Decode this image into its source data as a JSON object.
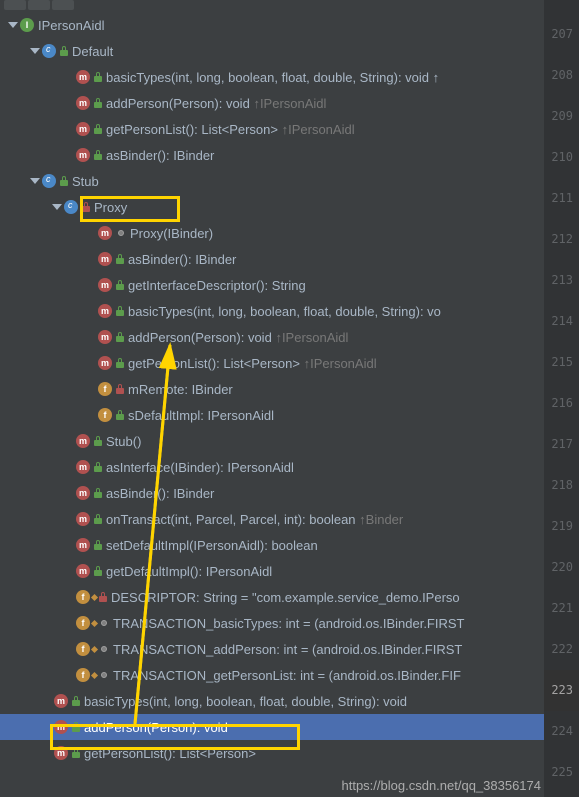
{
  "gutter": {
    "start": 207,
    "end": 225,
    "active": 223
  },
  "tree": {
    "root": {
      "label": "IPersonAidl",
      "children": [
        {
          "label": "Default",
          "methods": [
            {
              "sig": "basicTypes(int, long, boolean, float, double, String): void ↑"
            },
            {
              "sig": "addPerson(Person): void",
              "inherit": "↑IPersonAidl"
            },
            {
              "sig": "getPersonList(): List<Person>",
              "inherit": "↑IPersonAidl"
            },
            {
              "sig": "asBinder(): IBinder"
            }
          ]
        },
        {
          "label": "Stub",
          "proxy": {
            "label": "Proxy",
            "items": [
              {
                "type": "ctor",
                "sig": "Proxy(IBinder)"
              },
              {
                "type": "m",
                "sig": "asBinder(): IBinder"
              },
              {
                "type": "m",
                "sig": "getInterfaceDescriptor(): String"
              },
              {
                "type": "m",
                "sig": "basicTypes(int, long, boolean, float, double, String): vo"
              },
              {
                "type": "m",
                "sig": "addPerson(Person): void",
                "inherit": "↑IPersonAidl"
              },
              {
                "type": "m",
                "sig": "getPersonList(): List<Person>",
                "inherit": "↑IPersonAidl"
              },
              {
                "type": "f",
                "lock": "red",
                "sig": "mRemote: IBinder"
              },
              {
                "type": "f",
                "lock": "green",
                "sig": "sDefaultImpl: IPersonAidl"
              }
            ]
          },
          "stub_methods": [
            {
              "type": "m",
              "sig": "Stub()"
            },
            {
              "type": "m",
              "sig": "asInterface(IBinder): IPersonAidl"
            },
            {
              "type": "m",
              "sig": "asBinder(): IBinder"
            },
            {
              "type": "m",
              "sig": "onTransact(int, Parcel, Parcel, int): boolean",
              "inherit": "↑Binder"
            },
            {
              "type": "m",
              "sig": "setDefaultImpl(IPersonAidl): boolean"
            },
            {
              "type": "m",
              "sig": "getDefaultImpl(): IPersonAidl"
            },
            {
              "type": "f",
              "lock": "red",
              "sig": "DESCRIPTOR: String = \"com.example.service_demo.IPerso"
            },
            {
              "type": "f",
              "lock": "gray",
              "sig": "TRANSACTION_basicTypes: int = (android.os.IBinder.FIRST"
            },
            {
              "type": "f",
              "lock": "gray",
              "sig": "TRANSACTION_addPerson: int = (android.os.IBinder.FIRST"
            },
            {
              "type": "f",
              "lock": "gray",
              "sig": "TRANSACTION_getPersonList: int = (android.os.IBinder.FIF"
            }
          ]
        }
      ],
      "top_methods": [
        {
          "sig": "basicTypes(int, long, boolean, float, double, String): void"
        },
        {
          "sig": "addPerson(Person): void",
          "selected": true
        },
        {
          "sig": "getPersonList(): List<Person>"
        }
      ]
    }
  },
  "watermark": "https://blog.csdn.net/qq_38356174"
}
